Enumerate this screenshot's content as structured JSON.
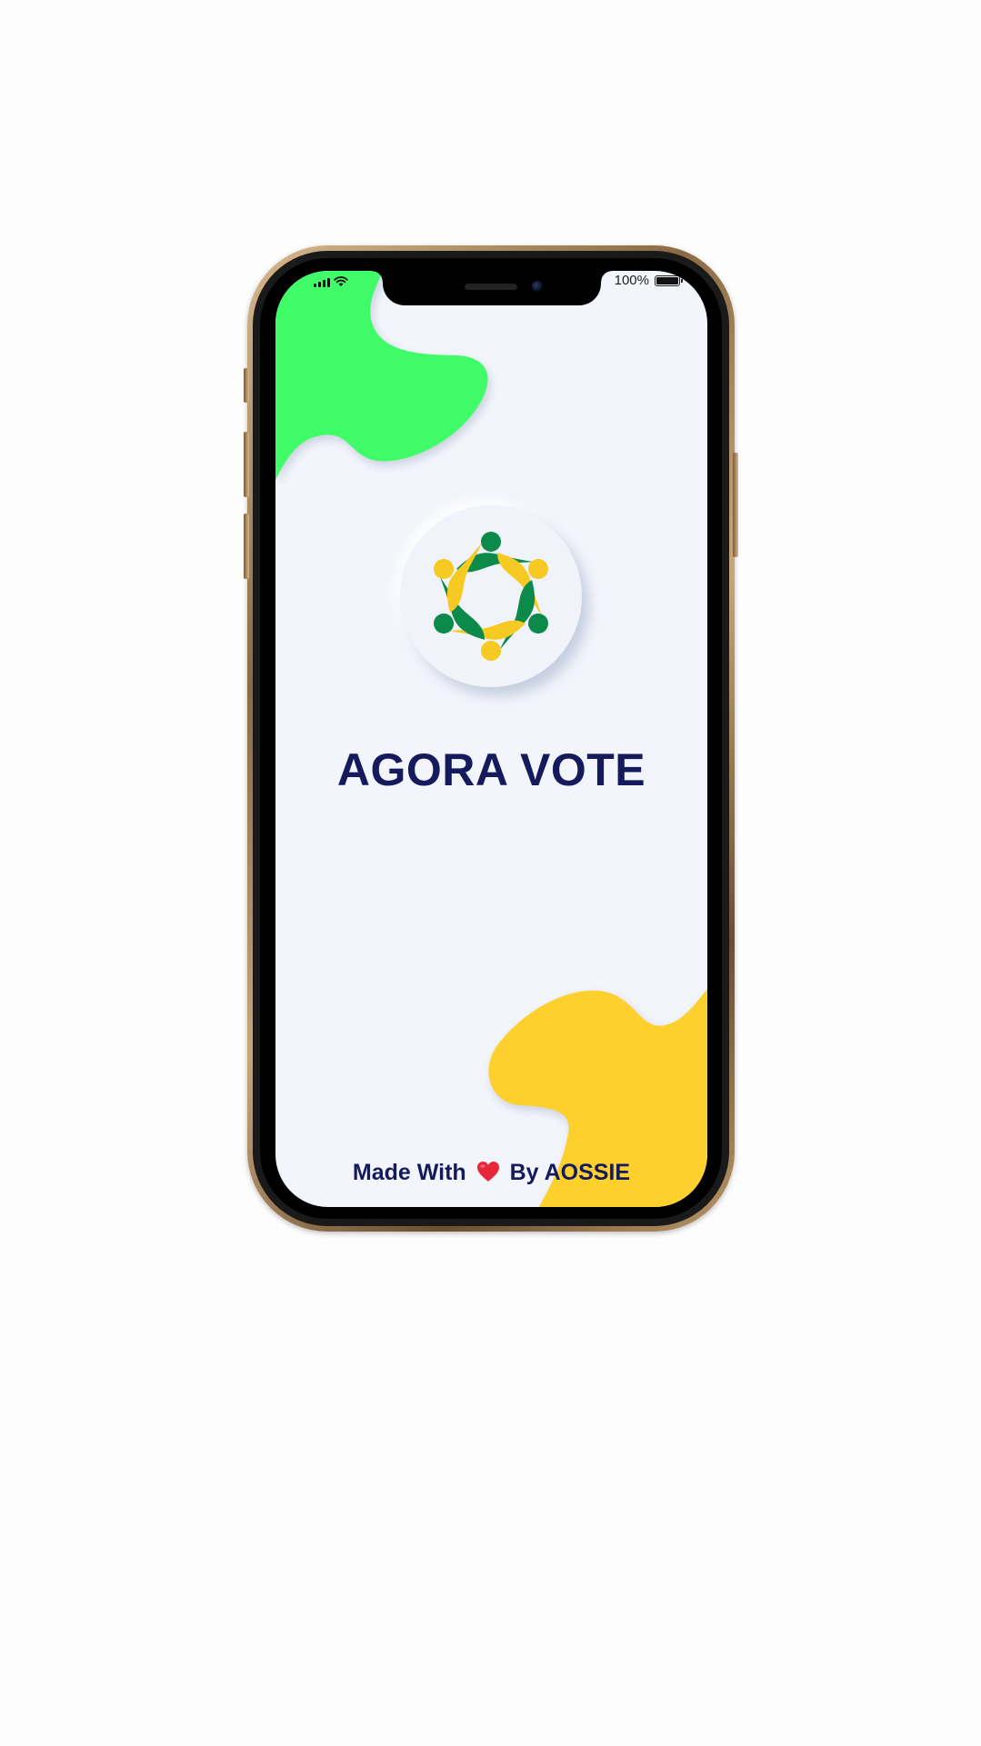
{
  "status_bar": {
    "battery_text": "100%",
    "icons": [
      "signal-icon",
      "wifi-icon",
      "battery-icon"
    ]
  },
  "splash": {
    "app_name": "AGORA VOTE",
    "footer_prefix": "Made With",
    "footer_suffix": "By AOSSIE",
    "footer_icon": "heart-icon"
  },
  "colors": {
    "screen_bg": "#f3f5fc",
    "title": "#141a5c",
    "blob_green": "#41fc69",
    "blob_yellow": "#fed02e",
    "logo_green": "#0b8a4a",
    "logo_yellow": "#f7c923",
    "heart": "#e8263a"
  }
}
